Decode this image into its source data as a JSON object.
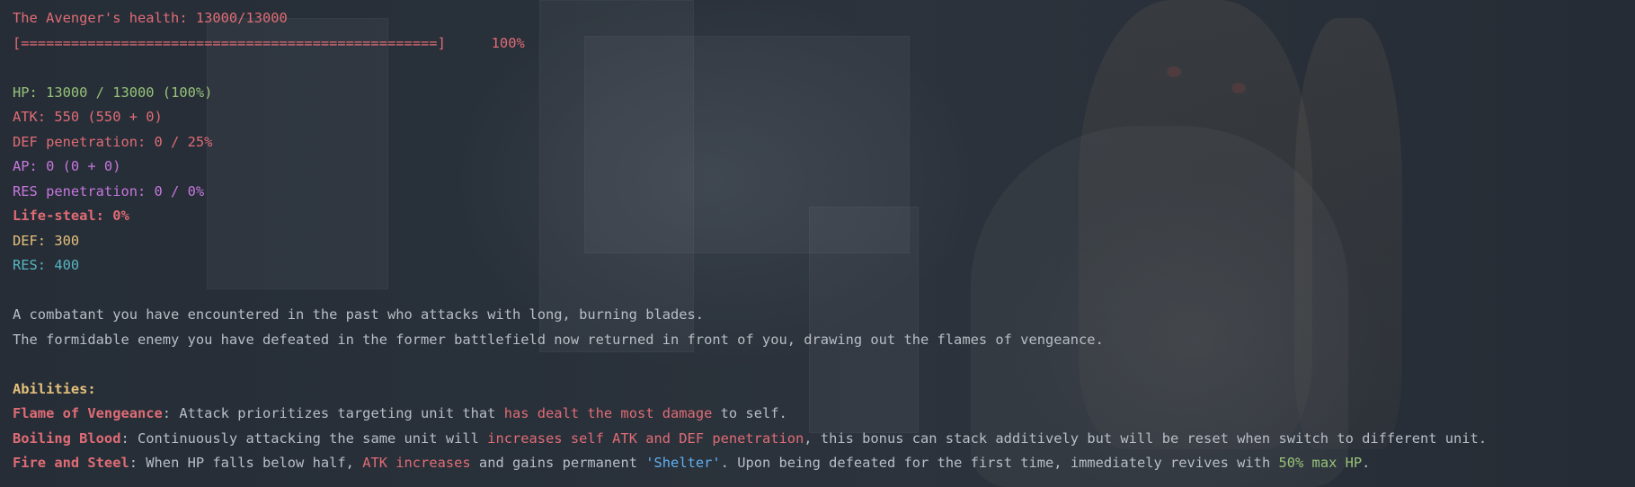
{
  "colors": {
    "red": "#e06c75",
    "green": "#98c379",
    "purple": "#c678dd",
    "yellow": "#e5c07b",
    "cyan": "#56b6c2",
    "blue": "#61afef",
    "text": "#b9bec6"
  },
  "health": {
    "title": "The Avenger's health: 13000/13000",
    "bar": "[==================================================]",
    "percent": "100%",
    "progress": 1.0
  },
  "stats": {
    "hp_label": "HP: ",
    "hp_value": "13000 / 13000 (100%)",
    "atk": "ATK: 550 (550 + 0)",
    "def_pen": "DEF penetration: 0 / 25%",
    "ap": "AP: 0 (0 + 0)",
    "res_pen": "RES penetration: 0 / 0%",
    "lifesteal": "Life-steal: 0%",
    "def_label": "DEF: ",
    "def_value": "300",
    "res_label": "RES: ",
    "res_value": "400"
  },
  "description": {
    "line1": "A combatant you have encountered in the past who attacks with long, burning blades.",
    "line2": "The formidable enemy you have defeated in the former battlefield now returned in front of you, drawing out the flames of vengeance."
  },
  "abilities": {
    "heading": "Abilities:",
    "flame": {
      "name": "Flame of Vengeance",
      "t1": ": Attack prioritizes targeting unit that ",
      "hl": "has dealt the most damage",
      "t2": " to self."
    },
    "boiling": {
      "name": "Boiling Blood",
      "t1": ": Continuously attacking the same unit will ",
      "hl": "increases self ATK and DEF penetration",
      "t2": ", this bonus can stack additively but will be reset when switch to different unit."
    },
    "fire": {
      "name": "Fire and Steel",
      "t1": ": When HP falls below half, ",
      "hl1": "ATK increases",
      "t2": " and gains permanent ",
      "hl2": "'Shelter'",
      "t3": ". Upon being defeated for the first time, immediately revives with ",
      "hl3": "50% max HP",
      "t4": "."
    }
  }
}
